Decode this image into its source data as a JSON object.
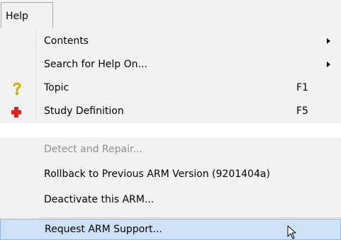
{
  "menubar": {
    "help_label": "Help"
  },
  "menu": {
    "contents": "Contents",
    "search": "Search for Help On...",
    "topic": "Topic",
    "topic_key": "F1",
    "study_definition": "Study Definition",
    "study_definition_key": "F5",
    "detect_repair": "Detect and Repair...",
    "rollback": "Rollback to Previous ARM Version (9201404a)",
    "deactivate": "Deactivate this ARM...",
    "request_support": "Request ARM Support..."
  },
  "colors": {
    "menu_bg": "#f2f2f2",
    "highlight_bg": "#cfe1f7",
    "highlight_border": "#8fb7e8",
    "disabled_text": "#8f8f8f",
    "topic_icon": "#e5c400",
    "cross_icon": "#e02020"
  },
  "icons": {
    "topic": "question-mark-icon",
    "study_definition": "red-cross-icon",
    "submenu": "submenu-arrow-icon",
    "cursor": "mouse-pointer-icon"
  }
}
